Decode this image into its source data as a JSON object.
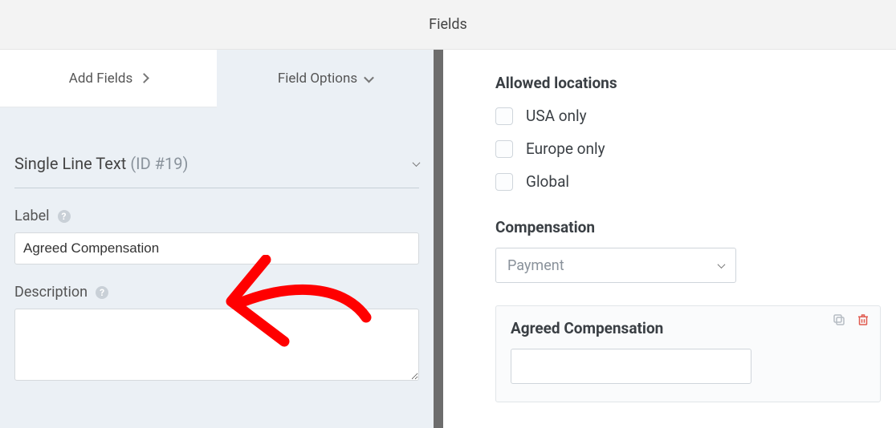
{
  "header": {
    "title": "Fields"
  },
  "tabs": {
    "add_label": "Add Fields",
    "options_label": "Field Options"
  },
  "field": {
    "type_label": "Single Line Text",
    "id_label": "(ID #19)",
    "label_label": "Label",
    "label_value": "Agreed Compensation",
    "description_label": "Description",
    "description_value": ""
  },
  "right": {
    "allowed_title": "Allowed locations",
    "locations": [
      "USA only",
      "Europe only",
      "Global"
    ],
    "compensation_title": "Compensation",
    "compensation_selected": "Payment",
    "preview_field_title": "Agreed Compensation"
  },
  "icons": {
    "help": "?",
    "duplicate": "copy-icon",
    "delete": "trash-icon"
  },
  "annotation": {
    "color": "#ff0000"
  }
}
